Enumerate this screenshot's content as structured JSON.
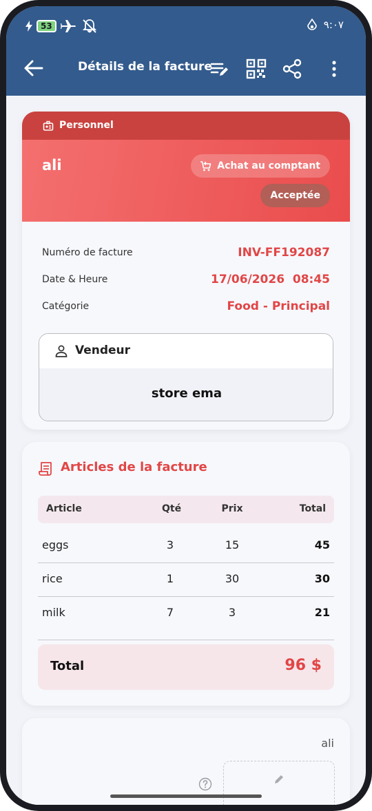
{
  "status_bar": {
    "battery": "53",
    "time": "٩:٠٧"
  },
  "app_bar": {
    "title": "Détails de la facture",
    "icons": [
      "back-arrow-icon",
      "edit-list-icon",
      "qr-code-icon",
      "share-icon",
      "more-vert-icon"
    ]
  },
  "invoice": {
    "account_type": "Personnel",
    "customer_name": "ali",
    "purchase_type": "Achat au comptant",
    "status": "Acceptée",
    "fields": [
      {
        "label": "Numéro de facture",
        "value": "INV-FF192087"
      },
      {
        "label": "Date & Heure",
        "value": "17/06/2026  08:45"
      },
      {
        "label": "Catégorie",
        "value": "Food - Principal"
      }
    ],
    "vendor": {
      "label": "Vendeur",
      "name": "store ema"
    }
  },
  "items_section": {
    "title": "Articles de la facture",
    "headers": {
      "article": "Article",
      "qty": "Qté",
      "price": "Prix",
      "total": "Total"
    },
    "rows": [
      {
        "article": "eggs",
        "qty": "3",
        "price": "15",
        "total": "45"
      },
      {
        "article": "rice",
        "qty": "1",
        "price": "30",
        "total": "30"
      },
      {
        "article": "milk",
        "qty": "7",
        "price": "3",
        "total": "21"
      }
    ],
    "total_label": "Total",
    "total_value": "96 $"
  },
  "signature": {
    "name": "ali"
  },
  "colors": {
    "header": "#335b8d",
    "accent": "#e14646",
    "hero": "#f05b5b"
  }
}
